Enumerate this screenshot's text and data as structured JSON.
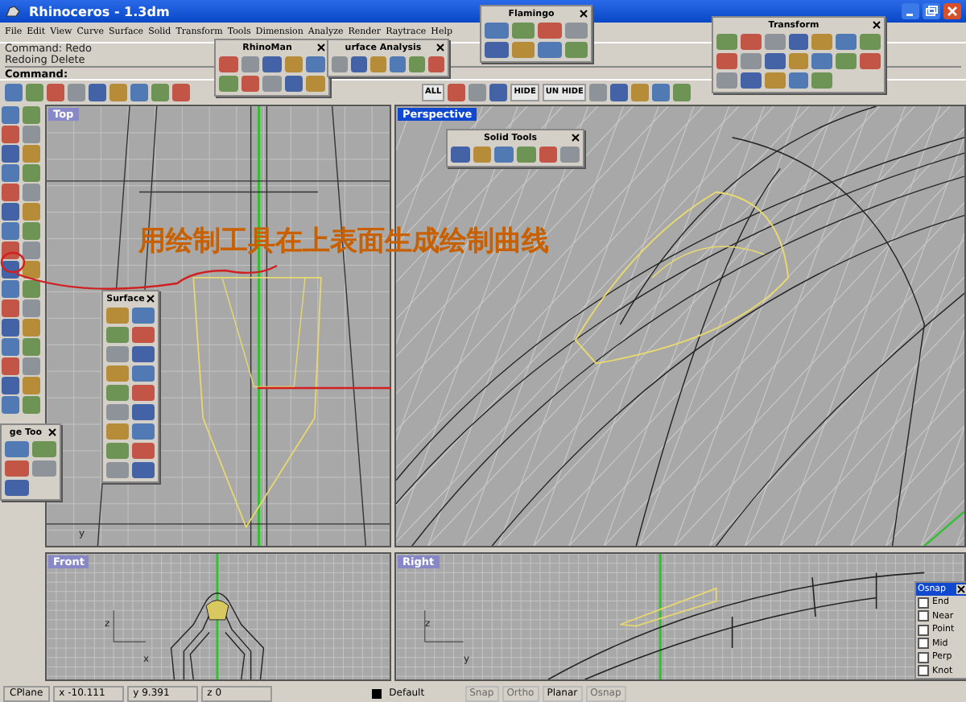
{
  "window": {
    "title": "Rhinoceros - 1.3dm"
  },
  "menu": [
    "File",
    "Edit",
    "View",
    "Curve",
    "Surface",
    "Solid",
    "Transform",
    "Tools",
    "Dimension",
    "Analyze",
    "Render",
    "Raytrace",
    "Help"
  ],
  "command": {
    "history": [
      "Command: Redo",
      "Redoing Delete"
    ],
    "prompt": "Command:"
  },
  "main_toolbar": {
    "text_buttons": [
      "ALL",
      "HIDE",
      "UN HIDE"
    ]
  },
  "viewports": [
    {
      "title": "Top",
      "selected": false,
      "axis_labels": [
        "y"
      ]
    },
    {
      "title": "Perspective",
      "selected": true
    },
    {
      "title": "Front",
      "selected": false,
      "axis_labels": [
        "z",
        "x"
      ]
    },
    {
      "title": "Right",
      "selected": false,
      "axis_labels": [
        "z",
        "y"
      ]
    }
  ],
  "annotation": "用绘制工具在上表面生成绘制曲线",
  "floating_toolbars": [
    {
      "title": "Flamingo"
    },
    {
      "title": "Transform"
    },
    {
      "title": "RhinoMan"
    },
    {
      "title": "urface Analysis"
    },
    {
      "title": "Solid Tools"
    },
    {
      "title": "Surface"
    },
    {
      "title": "ge Too"
    }
  ],
  "osnap": {
    "title": "Osnap",
    "items": [
      {
        "label": "End",
        "checked": false
      },
      {
        "label": "Near",
        "checked": false
      },
      {
        "label": "Point",
        "checked": false
      },
      {
        "label": "Mid",
        "checked": false
      },
      {
        "label": "Perp",
        "checked": false
      },
      {
        "label": "Knot",
        "checked": false
      }
    ]
  },
  "status_bar": {
    "cplane": "CPlane",
    "x": "x -10.111",
    "y": "y 9.391",
    "z": "z 0",
    "layer": "Default",
    "toggles": [
      {
        "label": "Snap",
        "selected": false
      },
      {
        "label": "Ortho",
        "selected": false
      },
      {
        "label": "Planar",
        "selected": true
      },
      {
        "label": "Osnap",
        "selected": false
      }
    ]
  }
}
